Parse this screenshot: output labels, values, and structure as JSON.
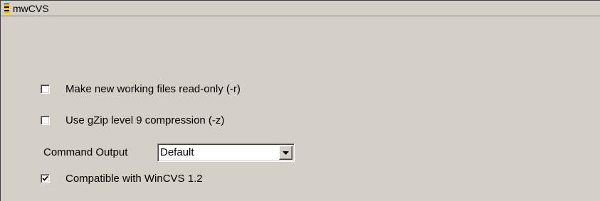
{
  "window": {
    "title": "mwCVS",
    "icon": "striped-app-icon"
  },
  "options": {
    "read_only": {
      "label": "Make new working files read-only (-r)",
      "checked": false
    },
    "gzip": {
      "label": "Use gZip level 9 compression (-z)",
      "checked": false
    },
    "command_output": {
      "label": "Command Output",
      "value": "Default"
    },
    "compat": {
      "label": "Compatible with WinCVS 1.2",
      "checked": true
    }
  },
  "colors": {
    "face": "#d4d0c8",
    "icon_stripe": "#f3c300"
  }
}
